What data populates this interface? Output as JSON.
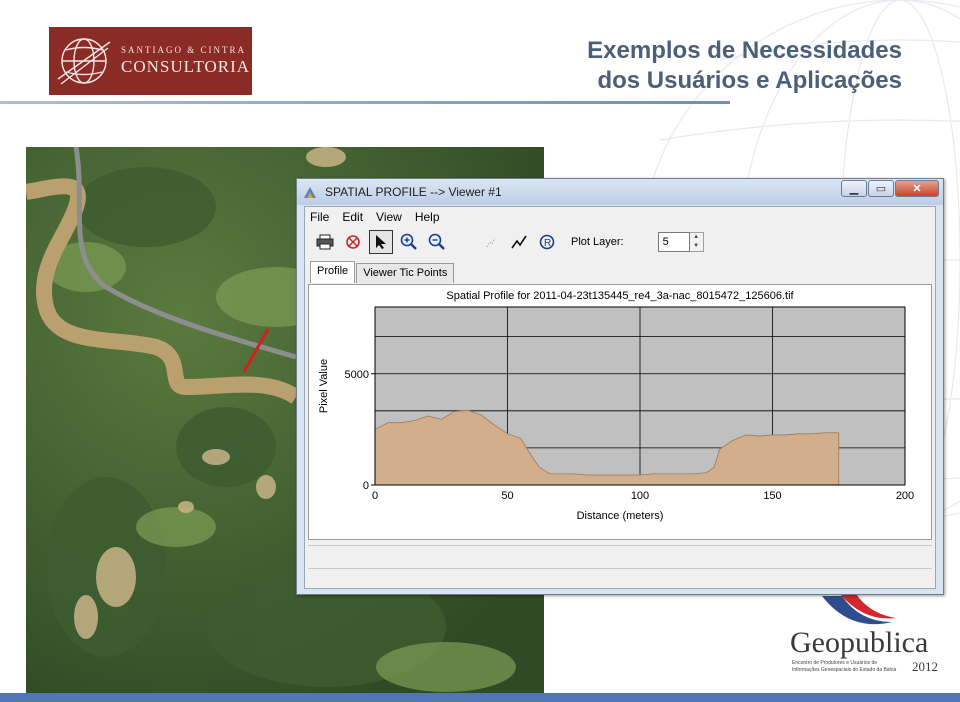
{
  "slide": {
    "title_line1": "Exemplos de Necessidades",
    "title_line2": "dos Usuários e Aplicações"
  },
  "logo": {
    "small_text": "SANTIAGO & CINTRA",
    "big_text": "CONSULTORIA"
  },
  "footer_logo": {
    "name": "Geopublica",
    "subtitle_line1": "Encontro de Produtores e Usuários de",
    "subtitle_line2": "Informações Geoespaciais do Estado da Bahia",
    "year": "2012"
  },
  "window": {
    "title": "SPATIAL PROFILE --> Viewer #1",
    "menu": [
      "File",
      "Edit",
      "View",
      "Help"
    ],
    "plot_layer_label": "Plot Layer:",
    "plot_layer_value": "5",
    "tabs": [
      "Profile",
      "Viewer Tic Points"
    ],
    "toolbar_icons": [
      "print-icon",
      "clear-icon",
      "select-arrow-icon",
      "zoom-in-icon",
      "zoom-out-icon",
      "point-icon",
      "polyline-icon",
      "refresh-icon"
    ]
  },
  "colors": {
    "plot_background": "#c0c0c0",
    "profile_fill": "#d2ae8c",
    "title_color": "#4a5f78",
    "logo_bg": "#8b2b26"
  },
  "chart_data": {
    "type": "area",
    "title": "Spatial Profile for 2011-04-23t135445_re4_3a-nac_8015472_125606.tif",
    "xlabel": "Distance (meters)",
    "ylabel": "Pixel Value",
    "xlim": [
      0,
      200
    ],
    "ylim": [
      0,
      8000
    ],
    "xticks": [
      0,
      50,
      100,
      150,
      200
    ],
    "yticks": [
      0,
      5000
    ],
    "grid": true,
    "series": [
      {
        "x": [
          0,
          5,
          10,
          15,
          20,
          25,
          30,
          35,
          40,
          45,
          50,
          55,
          58,
          62,
          66,
          70,
          75,
          80,
          85,
          90,
          95,
          100,
          105,
          110,
          115,
          120,
          125,
          128,
          130,
          135,
          140,
          145,
          150,
          155,
          160,
          165,
          170,
          175
        ],
        "y": [
          2500,
          2800,
          2800,
          2900,
          3100,
          2950,
          3300,
          3350,
          3150,
          2700,
          2300,
          2100,
          1500,
          800,
          500,
          500,
          500,
          450,
          450,
          450,
          450,
          450,
          500,
          500,
          500,
          500,
          550,
          800,
          1600,
          2000,
          2250,
          2200,
          2250,
          2250,
          2300,
          2300,
          2350,
          2350
        ]
      }
    ]
  }
}
